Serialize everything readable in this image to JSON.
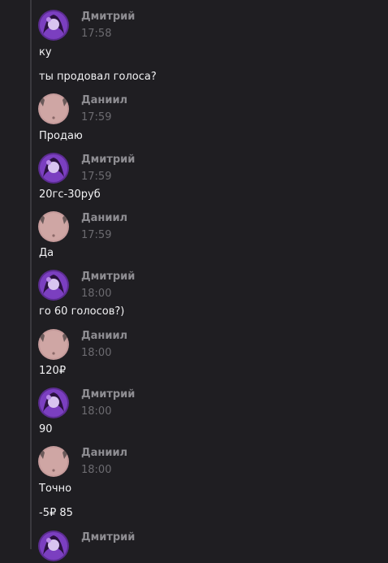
{
  "messages": [
    {
      "author": "Дмитрий",
      "avatar": "purple-anime-avatar",
      "time": "17:58",
      "lines": [
        "ку",
        "ты продовал голоса?"
      ]
    },
    {
      "author": "Даниил",
      "avatar": "pink-avatar",
      "time": "17:59",
      "lines": [
        "Продаю"
      ]
    },
    {
      "author": "Дмитрий",
      "avatar": "purple-anime-avatar",
      "time": "17:59",
      "lines": [
        "20гс-30руб"
      ]
    },
    {
      "author": "Даниил",
      "avatar": "pink-avatar",
      "time": "17:59",
      "lines": [
        "Да"
      ]
    },
    {
      "author": "Дмитрий",
      "avatar": "purple-anime-avatar",
      "time": "18:00",
      "lines": [
        "го 60 голосов?)"
      ]
    },
    {
      "author": "Даниил",
      "avatar": "pink-avatar",
      "time": "18:00",
      "lines": [
        "120₽"
      ]
    },
    {
      "author": "Дмитрий",
      "avatar": "purple-anime-avatar",
      "time": "18:00",
      "lines": [
        "90"
      ]
    },
    {
      "author": "Даниил",
      "avatar": "pink-avatar",
      "time": "18:00",
      "lines": [
        "Точно",
        "-5₽ 85"
      ]
    },
    {
      "author": "Дмитрий",
      "avatar": "purple-anime-avatar",
      "time": "",
      "lines": []
    }
  ],
  "colors": {
    "background": "#1f1e22",
    "author": "#8e8d92",
    "time": "#6c6b70",
    "text": "#f2f2f4",
    "purple_avatar": "#7b3fc0",
    "pink_avatar": "#c49a9a"
  }
}
